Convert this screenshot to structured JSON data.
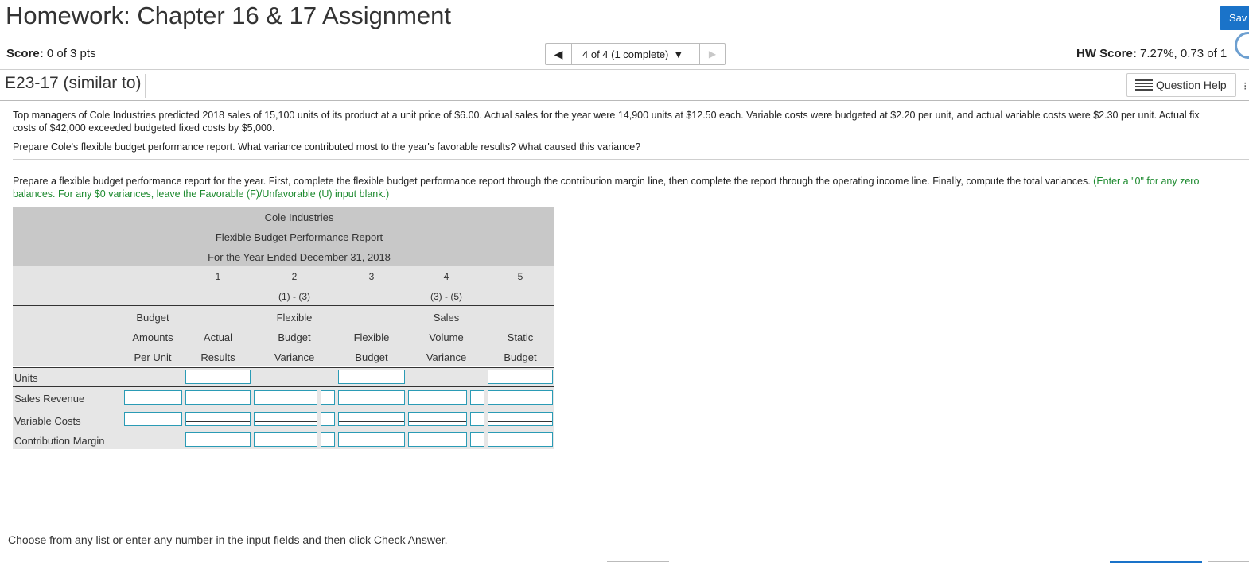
{
  "header": {
    "title": "Homework: Chapter 16 & 17 Assignment",
    "save_label": "Sav"
  },
  "score_bar": {
    "score_label": "Score:",
    "score_value": "0 of 3 pts",
    "nav_selector": "4 of 4 (1 complete)",
    "hw_score_label": "HW Score:",
    "hw_score_value": "7.27%, 0.73 of 1"
  },
  "question": {
    "name": "E23-17 (similar to)",
    "help_label": "Question Help",
    "text_line1": "Top managers of Cole Industries predicted 2018 sales of 15,100 units of its product at a unit price of $6.00. Actual sales for the year were 14,900 units at $12.50 each. Variable costs were budgeted at $2.20 per unit, and actual variable costs were $2.30 per unit. Actual fix",
    "text_line2": "costs of $42,000 exceeded budgeted fixed costs by $5,000.",
    "prompt": "Prepare Cole's flexible budget performance report. What variance contributed most to the year's favorable results? What caused this variance?",
    "instructions_main": "Prepare a flexible budget performance report for the year. First, complete the flexible budget performance report through the contribution margin line, then complete the report through the operating income line. Finally, compute the total variances.",
    "instructions_green_a": " (Enter a \"0\" for any zero",
    "instructions_green_b": "balances. For any $0 variances, leave the Favorable (F)/Unfavorable (U) input blank.)"
  },
  "report": {
    "company": "Cole Industries",
    "report_name": "Flexible Budget Performance Report",
    "period": "For the Year Ended December 31, 2018",
    "col_numbers": [
      "1",
      "2",
      "3",
      "4",
      "5"
    ],
    "col_formulas": {
      "c2": "(1) - (3)",
      "c4": "(3) - (5)"
    },
    "headers": {
      "per_unit": [
        "Budget",
        "Amounts",
        "Per Unit"
      ],
      "actual": [
        "Actual",
        "Results"
      ],
      "flex_var": [
        "Flexible",
        "Budget",
        "Variance"
      ],
      "flex": [
        "Flexible",
        "Budget"
      ],
      "sales_var": [
        "Sales",
        "Volume",
        "Variance"
      ],
      "static": [
        "Static",
        "Budget"
      ]
    },
    "rows": [
      "Units",
      "Sales Revenue",
      "Variable Costs",
      "Contribution Margin"
    ]
  },
  "footer": {
    "instruction": "Choose from any list or enter any number in the input fields and then click Check Answer."
  }
}
